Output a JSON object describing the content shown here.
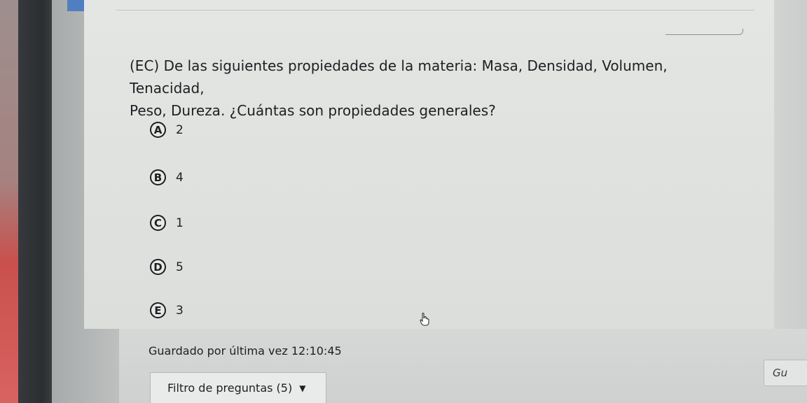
{
  "question": {
    "line1": "(EC) De las siguientes propiedades de la materia: Masa, Densidad, Volumen, Tenacidad,",
    "line2": "Peso, Dureza. ¿Cuántas son propiedades generales?"
  },
  "options": [
    {
      "letter": "A",
      "text": "2"
    },
    {
      "letter": "B",
      "text": "4"
    },
    {
      "letter": "C",
      "text": "1"
    },
    {
      "letter": "D",
      "text": "5"
    },
    {
      "letter": "E",
      "text": "3"
    }
  ],
  "status": {
    "saved_text": "Guardado por última vez 12:10:45"
  },
  "footer": {
    "filter_label": "Filtro de preguntas (5)",
    "filter_icon": "caret-down-icon",
    "save_partial_label": "Gu"
  },
  "colors": {
    "accent_tab": "#4f7fc0"
  }
}
